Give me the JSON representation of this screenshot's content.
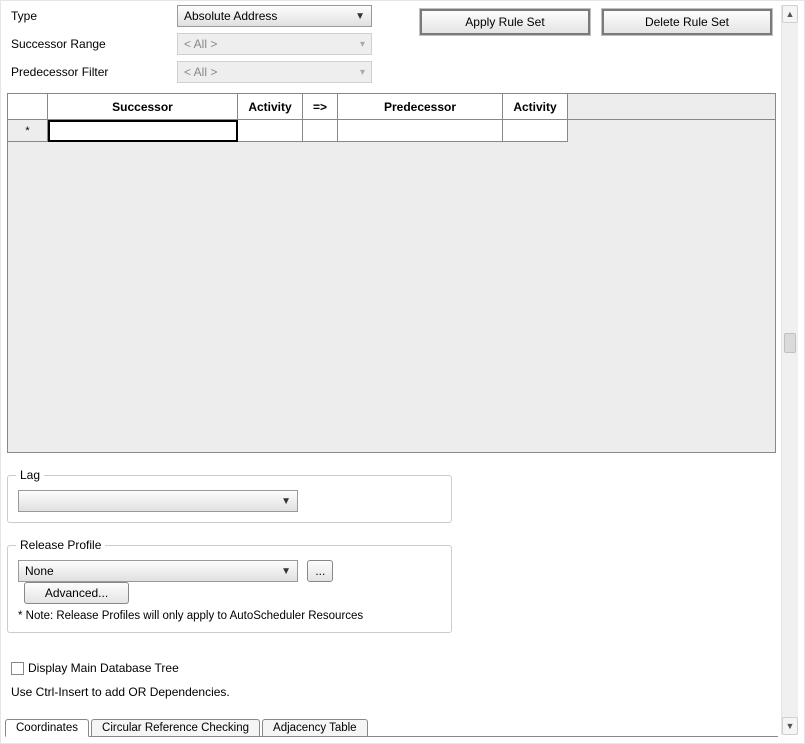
{
  "form": {
    "type_label": "Type",
    "type_value": "Absolute Address",
    "successor_range_label": "Successor Range",
    "successor_range_value": "< All >",
    "predecessor_filter_label": "Predecessor Filter",
    "predecessor_filter_value": "< All >"
  },
  "buttons": {
    "apply": "Apply Rule Set",
    "delete": "Delete Rule Set",
    "browse": "...",
    "advanced": "Advanced..."
  },
  "grid": {
    "columns": [
      "",
      "Successor",
      "Activity",
      "=>",
      "Predecessor",
      "Activity"
    ],
    "new_row_marker": "*",
    "rows": [
      {
        "successor": "",
        "activity1": "",
        "arrow": "",
        "predecessor": "",
        "activity2": ""
      }
    ]
  },
  "lag": {
    "legend": "Lag",
    "value": ""
  },
  "release": {
    "legend": "Release Profile",
    "value": "None",
    "note": "* Note: Release Profiles will only apply to AutoScheduler Resources"
  },
  "display_tree": {
    "checked": false,
    "label": "Display Main Database Tree"
  },
  "hint": "Use Ctrl-Insert to add OR Dependencies.",
  "tabs": {
    "items": [
      "Coordinates",
      "Circular Reference Checking",
      "Adjacency Table"
    ],
    "active_index": 0
  }
}
